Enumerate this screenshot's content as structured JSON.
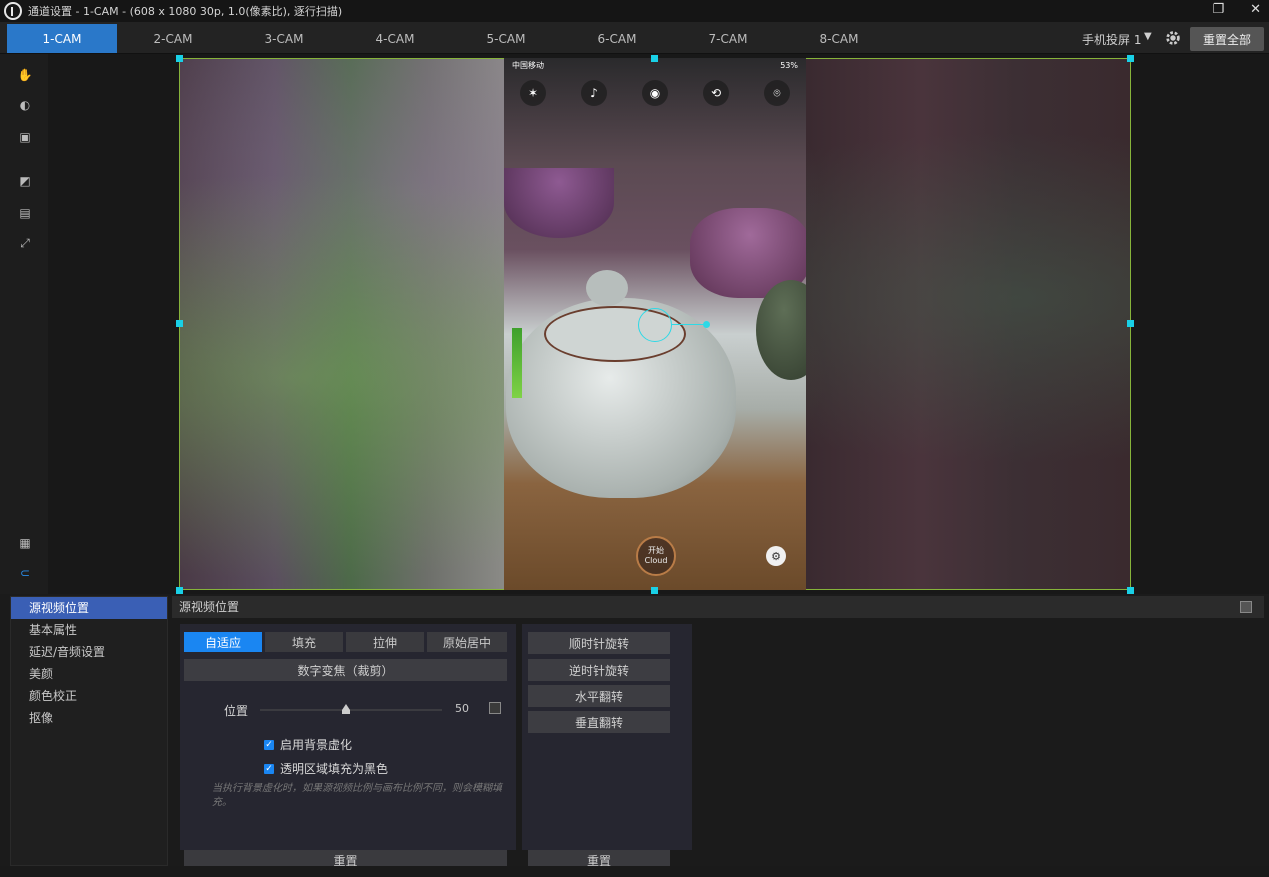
{
  "window": {
    "title": "通道设置 - 1-CAM - (608 x 1080 30p, 1.0(像素比), 逐行扫描)",
    "restore": "❐",
    "close": "✕"
  },
  "tabs": [
    "1-CAM",
    "2-CAM",
    "3-CAM",
    "4-CAM",
    "5-CAM",
    "6-CAM",
    "7-CAM",
    "8-CAM"
  ],
  "active_tab": "1-CAM",
  "toolbar": {
    "mirror_label": "手机投屏 1",
    "reset_all": "重置全部"
  },
  "phone": {
    "carrier": "中国移动",
    "battery": "53%",
    "start_line1": "开始",
    "start_line2": "Cloud"
  },
  "sidebar": {
    "items": [
      "源视频位置",
      "基本属性",
      "延迟/音频设置",
      "美颜",
      "颜色校正",
      "抠像"
    ],
    "active": "源视频位置"
  },
  "panel": {
    "title": "源视频位置",
    "modes": [
      "自适应",
      "填充",
      "拉伸",
      "原始居中"
    ],
    "active_mode": "自适应",
    "digital_zoom": "数字变焦（裁剪）",
    "position_label": "位置",
    "position_value": "50",
    "enable_bg_blur": "启用背景虚化",
    "fill_black": "透明区域填充为黑色",
    "note": "当执行背景虚化时，如果源视频比例与画布比例不同，则会模糊填充。",
    "reset": "重置"
  },
  "rotate_panel": {
    "cw": "顺时针旋转",
    "ccw": "逆时针旋转",
    "flip_h": "水平翻转",
    "flip_v": "垂直翻转",
    "reset": "重置"
  },
  "colors": {
    "accent": "#1a86f2",
    "tab_active": "#2a78c9",
    "selection_border": "#86b33a",
    "handle": "#19d0e6"
  }
}
